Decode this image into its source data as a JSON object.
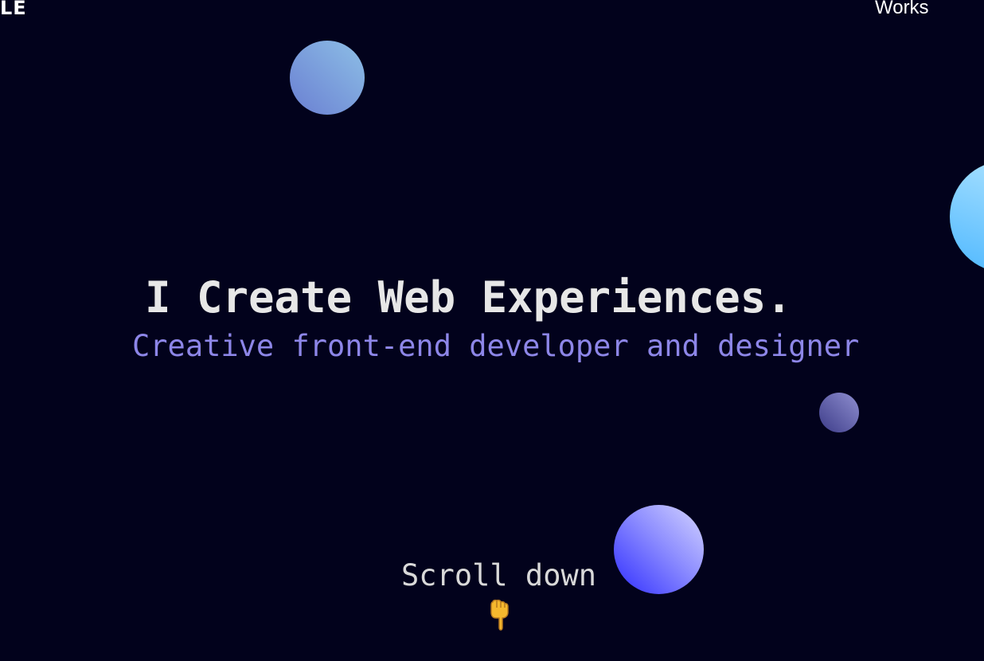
{
  "header": {
    "logo_text": "LE",
    "nav": {
      "works_label": "Works"
    }
  },
  "hero": {
    "headline": "I Create Web Experiences.",
    "subtitle": "Creative front-end developer and designer",
    "scroll_label": "Scroll down",
    "scroll_icon": "pointing-down-hand-icon"
  },
  "colors": {
    "background": "#02021c",
    "headline": "#e7e7e7",
    "subtitle": "#8d86e8",
    "hand": "#f5b82e"
  }
}
